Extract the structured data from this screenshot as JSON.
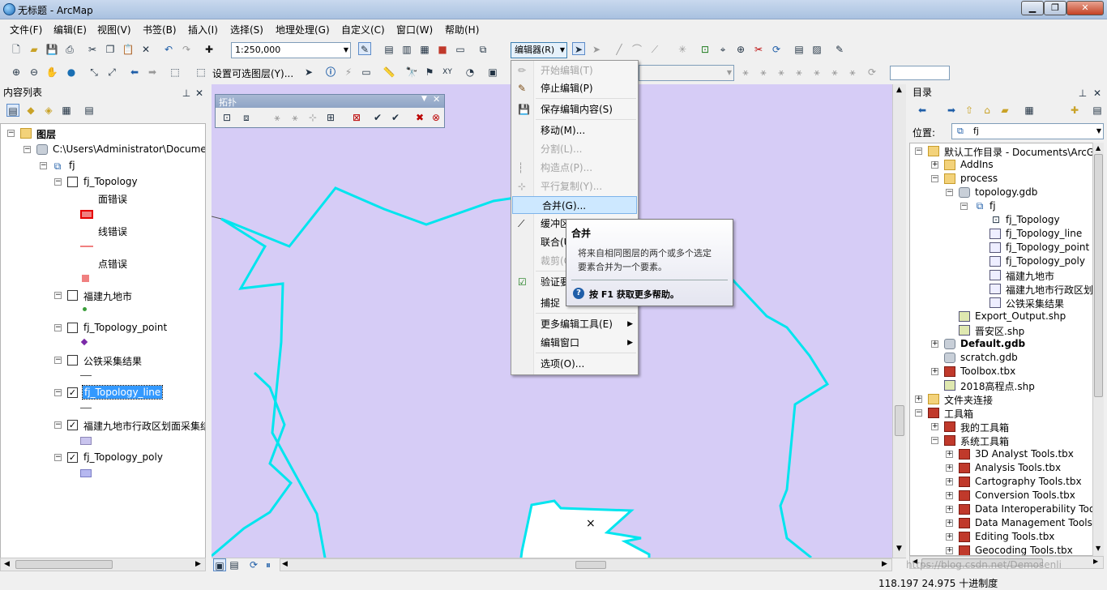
{
  "window": {
    "title": "无标题 - ArcMap"
  },
  "menubar": [
    "文件(F)",
    "编辑(E)",
    "视图(V)",
    "书签(B)",
    "插入(I)",
    "选择(S)",
    "地理处理(G)",
    "自定义(C)",
    "窗口(W)",
    "帮助(H)"
  ],
  "toolbar": {
    "scale": "1:250,000",
    "editor_label": "编辑器(R)",
    "select_layers_label": "设置可选图层(Y)..."
  },
  "toc": {
    "title": "内容列表",
    "layers_root": "图层",
    "path": "C:\\Users\\Administrator\\Documen",
    "dataset": "fj",
    "topology": "fj_Topology",
    "legend": {
      "area_error": "面错误",
      "line_error": "线错误",
      "point_error": "点错误"
    },
    "layers": [
      {
        "name": "福建九地市",
        "checked": false
      },
      {
        "name": "fj_Topology_point",
        "checked": false
      },
      {
        "name": "公铁采集结果",
        "checked": false
      },
      {
        "name": "fj_Topology_line",
        "checked": true
      },
      {
        "name": "福建九地市行政区划面采集结",
        "checked": true
      },
      {
        "name": "fj_Topology_poly",
        "checked": true
      }
    ],
    "check_mark": "✓"
  },
  "topology_toolbar": {
    "title": "拓扑"
  },
  "editor_menu": {
    "items": [
      {
        "label": "开始编辑(T)",
        "disabled": true
      },
      {
        "label": "停止编辑(P)",
        "disabled": false
      },
      {
        "label": "保存编辑内容(S)",
        "disabled": false
      },
      {
        "label": "移动(M)...",
        "disabled": false
      },
      {
        "label": "分割(L)...",
        "disabled": true
      },
      {
        "label": "构造点(P)...",
        "disabled": true
      },
      {
        "label": "平行复制(Y)...",
        "disabled": true
      },
      {
        "label": "合并(G)...",
        "disabled": false
      },
      {
        "label": "缓冲区",
        "disabled": false
      },
      {
        "label": "联合(U",
        "disabled": false
      },
      {
        "label": "裁剪(C",
        "disabled": true
      },
      {
        "label": "验证要",
        "disabled": false
      },
      {
        "label": "捕捉",
        "disabled": false
      },
      {
        "label": "更多编辑工具(E)",
        "disabled": false
      },
      {
        "label": "编辑窗口",
        "disabled": false
      },
      {
        "label": "选项(O)...",
        "disabled": false
      }
    ]
  },
  "tooltip": {
    "title": "合并",
    "body_line1": "将来自相同图层的两个或多个选定",
    "body_line2": "要素合并为一个要素。",
    "help_key": "按 F1 获取更多帮助。"
  },
  "catalog": {
    "title": "目录",
    "location_label": "位置:",
    "location_value": "fj",
    "items": [
      "默认工作目录 - Documents\\ArcG",
      "AddIns",
      "process",
      "topology.gdb",
      "fj",
      "fj_Topology",
      "fj_Topology_line",
      "fj_Topology_point",
      "fj_Topology_poly",
      "福建九地市",
      "福建九地市行政区划",
      "公铁采集结果",
      "Export_Output.shp",
      "晋安区.shp",
      "Default.gdb",
      "scratch.gdb",
      "Toolbox.tbx",
      "2018高程点.shp",
      "文件夹连接",
      "工具箱",
      "我的工具箱",
      "系统工具箱",
      "3D Analyst Tools.tbx",
      "Analysis Tools.tbx",
      "Cartography Tools.tbx",
      "Conversion Tools.tbx",
      "Data Interoperability Too",
      "Data Management Tools",
      "Editing Tools.tbx",
      "Geocoding Tools.tbx"
    ]
  },
  "status": {
    "coords": "118.197  24.975 十进制度",
    "watermark": "https://blog.csdn.net/Demosenli"
  },
  "colors": {
    "map_fill": "#d6ccf6",
    "boundary": "#00e5ee",
    "menu_highlight": "#cde8ff",
    "selected_layer": "#3399ff"
  }
}
